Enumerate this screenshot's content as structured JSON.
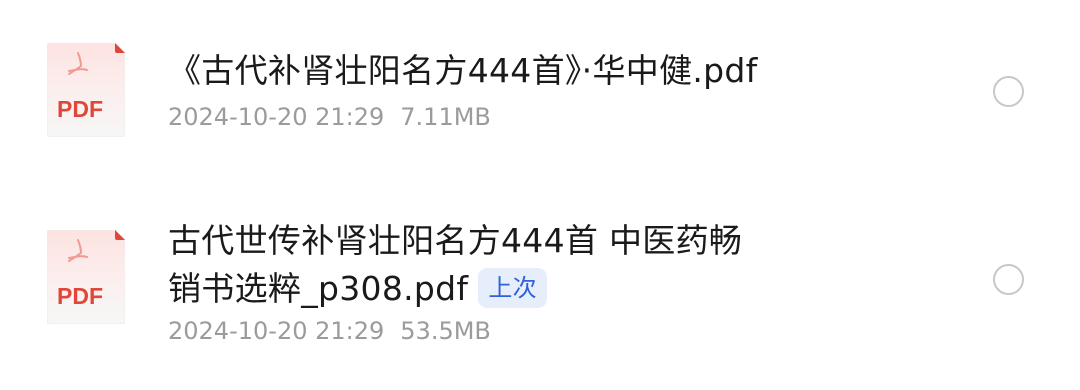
{
  "files": [
    {
      "name": "《古代补肾壮阳名方444首》·华中健.pdf",
      "date": "2024-10-20 21:29",
      "size": "7.11MB",
      "icon": "pdf-icon",
      "icon_label": "PDF"
    },
    {
      "name_line1": "古代世传补肾壮阳名方444首  中医药畅",
      "name_line2": "销书选粹_p308.pdf",
      "badge": "上次",
      "date": "2024-10-20 21:29",
      "size": "53.5MB",
      "icon": "pdf-icon",
      "icon_label": "PDF"
    }
  ],
  "colors": {
    "pdf_red": "#e0473a",
    "badge_bg": "#e6eefc",
    "badge_text": "#2f62d6",
    "meta_text": "#9b9b9b"
  }
}
